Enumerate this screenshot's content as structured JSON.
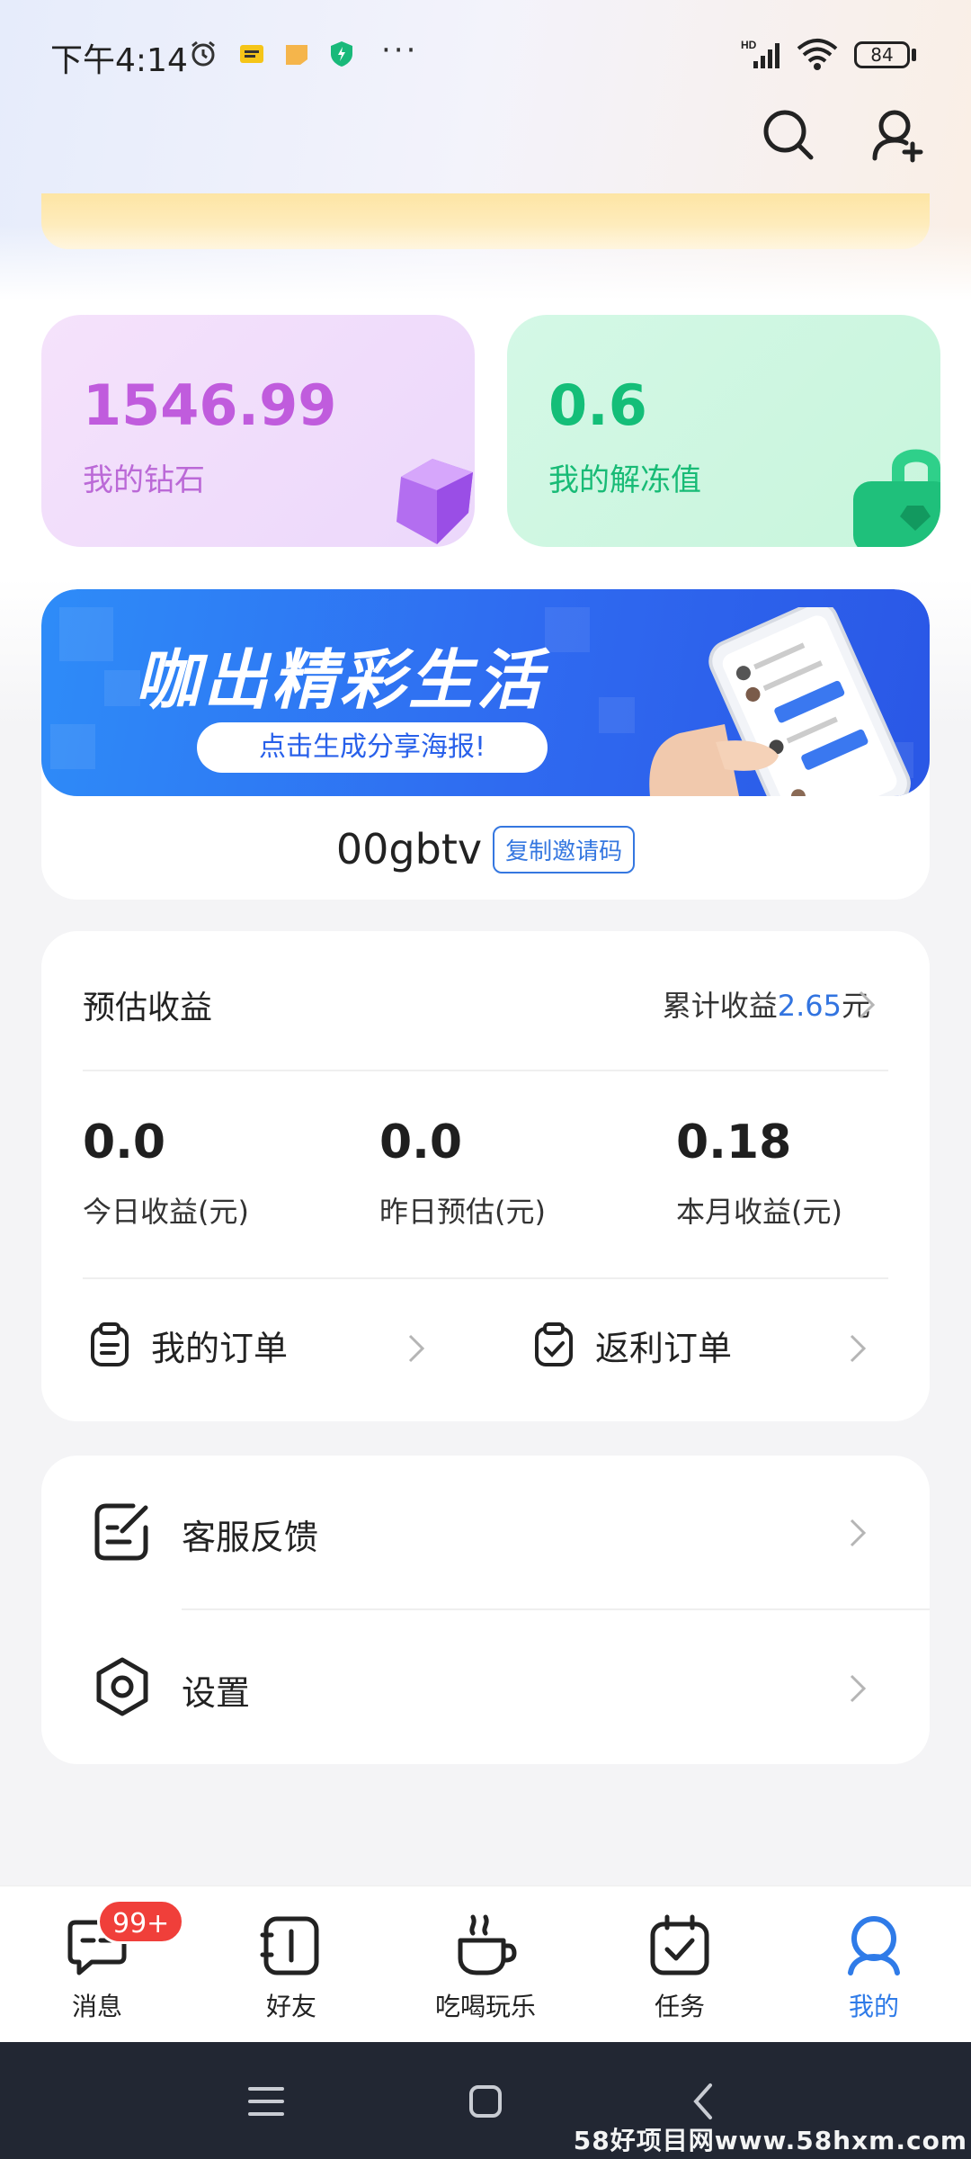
{
  "status_bar": {
    "time": "下午4:14",
    "dots": "···",
    "battery": "84"
  },
  "stats": {
    "diamond_value": "1546.99",
    "diamond_label": "我的钻石",
    "unfreeze_value": "0.6",
    "unfreeze_label": "我的解冻值"
  },
  "invite": {
    "banner_title": "咖出精彩生活",
    "banner_button": "点击生成分享海报!",
    "code": "00gbtv",
    "copy_label": "复制邀请码"
  },
  "earnings": {
    "title": "预估收益",
    "total_prefix": "累计收益",
    "total_amount": "2.65",
    "total_suffix": "元",
    "metrics": [
      {
        "value": "0.0",
        "label": "今日收益(元)"
      },
      {
        "value": "0.0",
        "label": "昨日预估(元)"
      },
      {
        "value": "0.18",
        "label": "本月收益(元)"
      }
    ],
    "orders": [
      {
        "label": "我的订单"
      },
      {
        "label": "返利订单"
      }
    ]
  },
  "services": [
    {
      "label": "客服反馈",
      "icon": "feedback-icon"
    },
    {
      "label": "设置",
      "icon": "settings-icon"
    }
  ],
  "bottom_nav": {
    "tabs": [
      {
        "label": "消息",
        "icon": "message-icon",
        "badge": "99+"
      },
      {
        "label": "好友",
        "icon": "contacts-icon"
      },
      {
        "label": "吃喝玩乐",
        "icon": "coffee-icon"
      },
      {
        "label": "任务",
        "icon": "calendar-check-icon"
      },
      {
        "label": "我的",
        "icon": "profile-icon"
      }
    ],
    "active_index": 4,
    "active_color": "#2f7be8"
  },
  "watermark": "58好项目网www.58hxm.com"
}
